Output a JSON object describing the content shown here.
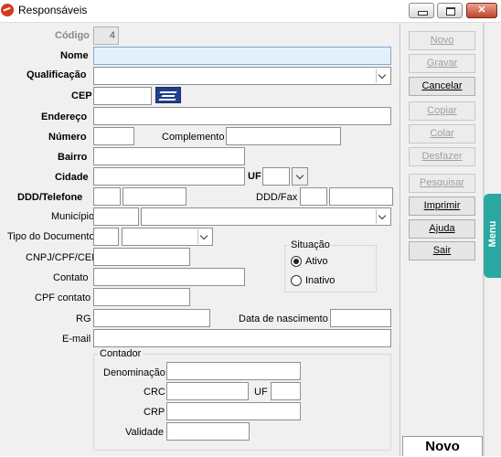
{
  "window": {
    "title": "Responsáveis"
  },
  "form": {
    "codigo_label": "Código",
    "codigo_value": "4",
    "nome_label": "Nome",
    "qualificacao_label": "Qualificação",
    "cep_label": "CEP",
    "endereco_label": "Endereço",
    "numero_label": "Número",
    "complemento_label": "Complemento",
    "bairro_label": "Bairro",
    "cidade_label": "Cidade",
    "uf_label": "UF",
    "ddd_telefone_label": "DDD/Telefone",
    "ddd_fax_label": "DDD/Fax",
    "municipio_label": "Município",
    "tipo_documento_label": "Tipo do Documento",
    "cnpj_label": "CNPJ/CPF/CEI",
    "contato_label": "Contato",
    "cpf_contato_label": "CPF contato",
    "rg_label": "RG",
    "data_nascimento_label": "Data de nascimento",
    "email_label": "E-mail"
  },
  "situacao": {
    "title": "Situação",
    "options": [
      {
        "label": "Ativo",
        "selected": true
      },
      {
        "label": "Inativo",
        "selected": false
      }
    ]
  },
  "contador": {
    "title": "Contador",
    "denominacao_label": "Denominação",
    "crc_label": "CRC",
    "uf_label": "UF",
    "crp_label": "CRP",
    "validade_label": "Validade"
  },
  "actions": [
    {
      "label": "Novo",
      "enabled": false
    },
    {
      "label": "Gravar",
      "enabled": false
    },
    {
      "label": "Cancelar",
      "enabled": true
    },
    {
      "label": "Copiar",
      "enabled": false
    },
    {
      "label": "Colar",
      "enabled": false
    },
    {
      "label": "Desfazer",
      "enabled": false
    },
    {
      "label": "Pesquisar",
      "enabled": false
    },
    {
      "label": "Imprimir",
      "enabled": true
    },
    {
      "label": "Ajuda",
      "enabled": true
    },
    {
      "label": "Sair",
      "enabled": true
    }
  ],
  "menu_tab": {
    "label": "Menu"
  },
  "status": {
    "mode": "Novo"
  },
  "colors": {
    "menu_tab": "#2aa9a2",
    "focus_field": "#e3f0fb",
    "close_button": "#c0432b"
  }
}
